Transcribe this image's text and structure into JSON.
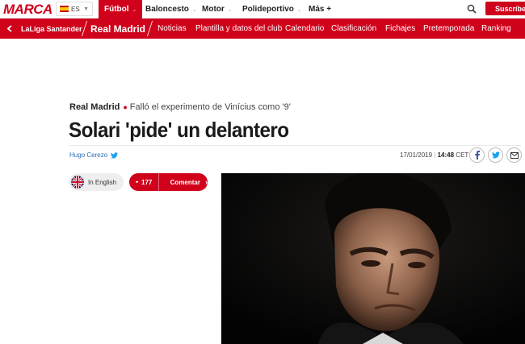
{
  "topnav": {
    "logo": "MARCA",
    "language": "ES",
    "sports": [
      {
        "label": "Fútbol",
        "active": true
      },
      {
        "label": "Baloncesto"
      },
      {
        "label": "Motor"
      },
      {
        "label": "Polideportivo"
      },
      {
        "label": "Más +"
      }
    ],
    "subscribe_label": "Suscríbete"
  },
  "section_bar": {
    "league": "LaLiga Santander",
    "team": "Real Madrid",
    "items": [
      "Noticias",
      "Plantilla y datos del club",
      "Calendario",
      "Clasificación",
      "Fichajes",
      "Pretemporada",
      "Ranking"
    ]
  },
  "article": {
    "section": "Real Madrid",
    "subtitle": "Falló el experimento de Vinícius como '9'",
    "headline": "Solari 'pide' un delantero",
    "author": "Hugo Cerezo",
    "date": "17/01/2019",
    "time": "14:48",
    "timezone": "CET"
  },
  "actions": {
    "english_label": "In English",
    "comment_count": "177",
    "comment_label": "Comentar"
  },
  "colors": {
    "brand_red": "#d0021b",
    "link_blue": "#2a6db5"
  },
  "icons": [
    "search-icon",
    "back-arrow-icon",
    "twitter-icon",
    "facebook-icon",
    "email-icon",
    "comment-icon",
    "uk-flag-icon",
    "spain-flag-icon"
  ]
}
